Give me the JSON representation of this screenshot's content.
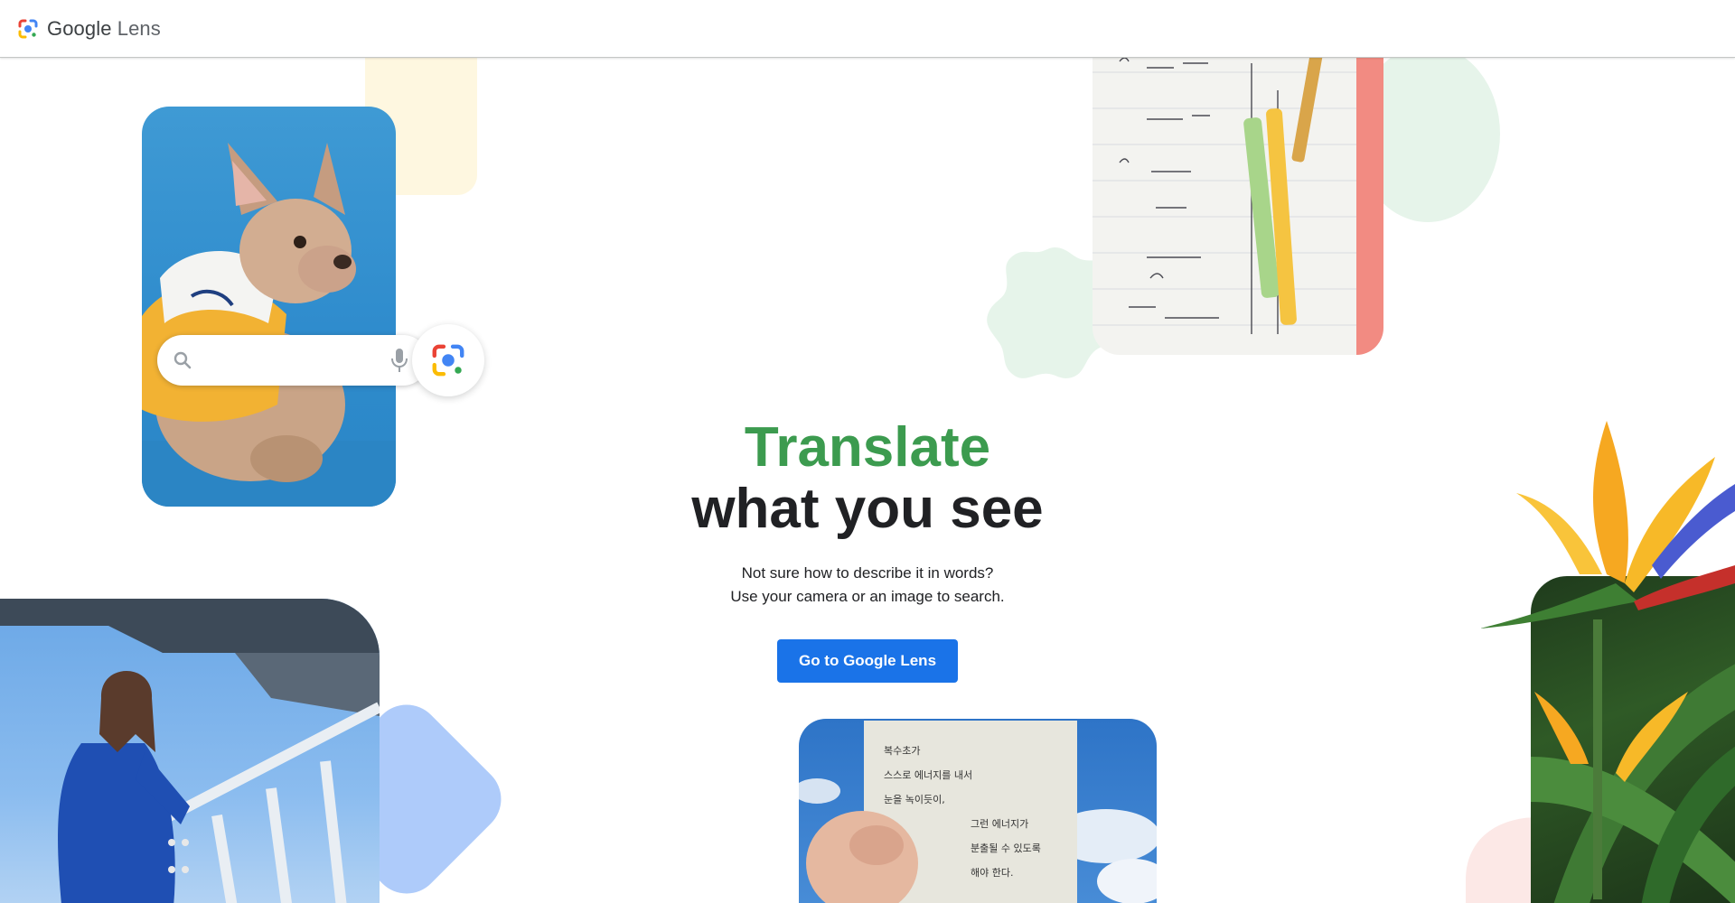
{
  "header": {
    "logo_brand": "Google",
    "logo_product": "Lens",
    "logo_icon": "google-lens-icon"
  },
  "hero": {
    "title_line1": "Translate",
    "title_line2": "what you see",
    "subtitle_line1": "Not sure how to describe it in words?",
    "subtitle_line2": "Use your camera or an image to search.",
    "cta_label": "Go to Google Lens"
  },
  "search_widget": {
    "search_icon": "search-icon",
    "mic_icon": "mic-icon",
    "lens_icon": "google-lens-icon"
  },
  "korean_note": {
    "lines": [
      "복수초가",
      "스스로 에너지를 내서",
      "눈을 녹이듯이,",
      "그런 에너지가",
      "분출될 수 있도록",
      "해야 한다."
    ]
  },
  "colors": {
    "accent_blue": "#1a73e8",
    "title_green": "#3c9b4f",
    "blob_yellow": "#fef7e0",
    "blob_green": "#e6f4ea",
    "blob_blue": "#aecbfa",
    "blob_pink": "#fce8e6"
  }
}
